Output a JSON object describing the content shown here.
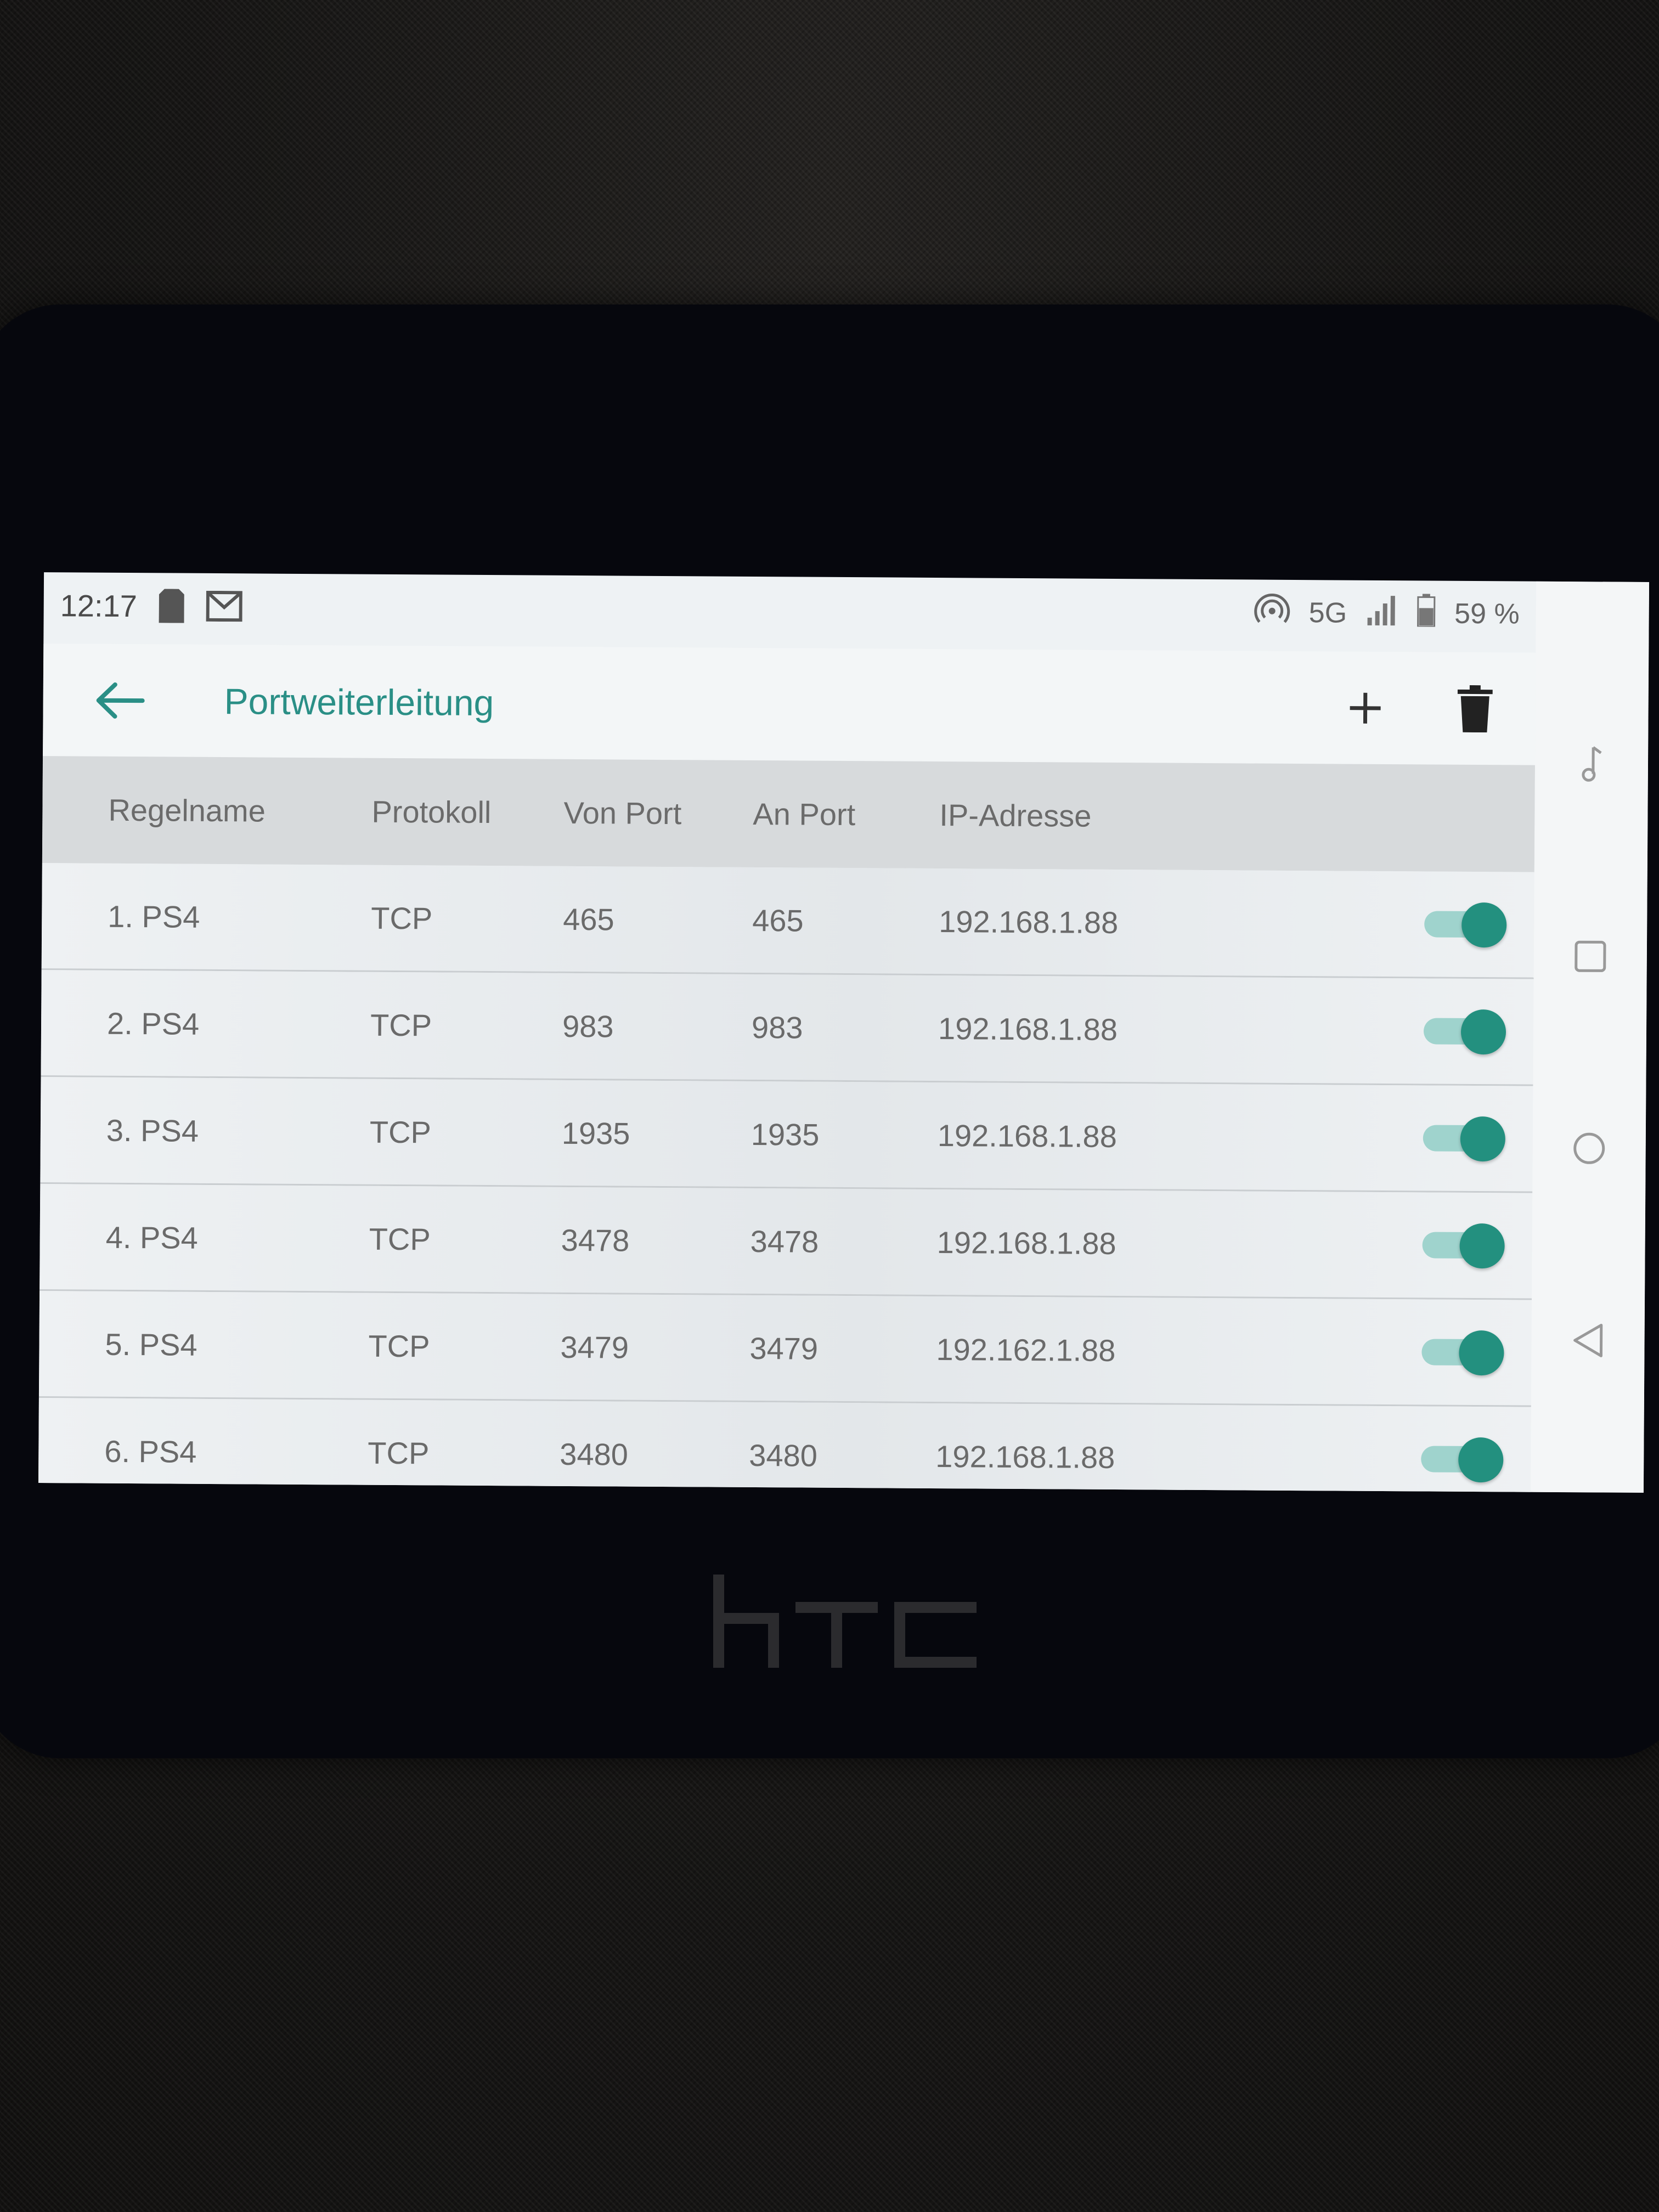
{
  "status_bar": {
    "time": "12:17",
    "network": "5G",
    "battery": "59 %",
    "icons": [
      "sim-card-icon",
      "mail-icon",
      "hotspot-icon",
      "network-5g-icon",
      "signal-icon",
      "battery-icon"
    ]
  },
  "app_bar": {
    "title": "Portweiterleitung",
    "back_icon": "back-arrow-icon",
    "add_icon": "plus-icon",
    "delete_icon": "trash-icon"
  },
  "table": {
    "headers": [
      "Regelname",
      "Protokoll",
      "Von Port",
      "An Port",
      "IP-Adresse"
    ],
    "rows": [
      {
        "name": "1. PS4",
        "protocol": "TCP",
        "from_port": "465",
        "to_port": "465",
        "ip": "192.168.1.88",
        "enabled": true
      },
      {
        "name": "2. PS4",
        "protocol": "TCP",
        "from_port": "983",
        "to_port": "983",
        "ip": "192.168.1.88",
        "enabled": true
      },
      {
        "name": "3. PS4",
        "protocol": "TCP",
        "from_port": "1935",
        "to_port": "1935",
        "ip": "192.168.1.88",
        "enabled": true
      },
      {
        "name": "4. PS4",
        "protocol": "TCP",
        "from_port": "3478",
        "to_port": "3478",
        "ip": "192.168.1.88",
        "enabled": true
      },
      {
        "name": "5. PS4",
        "protocol": "TCP",
        "from_port": "3479",
        "to_port": "3479",
        "ip": "192.162.1.88",
        "enabled": true
      },
      {
        "name": "6. PS4",
        "protocol": "TCP",
        "from_port": "3480",
        "to_port": "3480",
        "ip": "192.168.1.88",
        "enabled": true
      }
    ]
  },
  "nav_bar": {
    "icons": [
      "music-note-icon",
      "recents-square-icon",
      "home-circle-icon",
      "back-triangle-icon"
    ]
  },
  "colors": {
    "accent": "#2a8f86",
    "toggle_thumb": "#23907f",
    "toggle_track": "#9fd3cd"
  },
  "device_logo": "htc"
}
